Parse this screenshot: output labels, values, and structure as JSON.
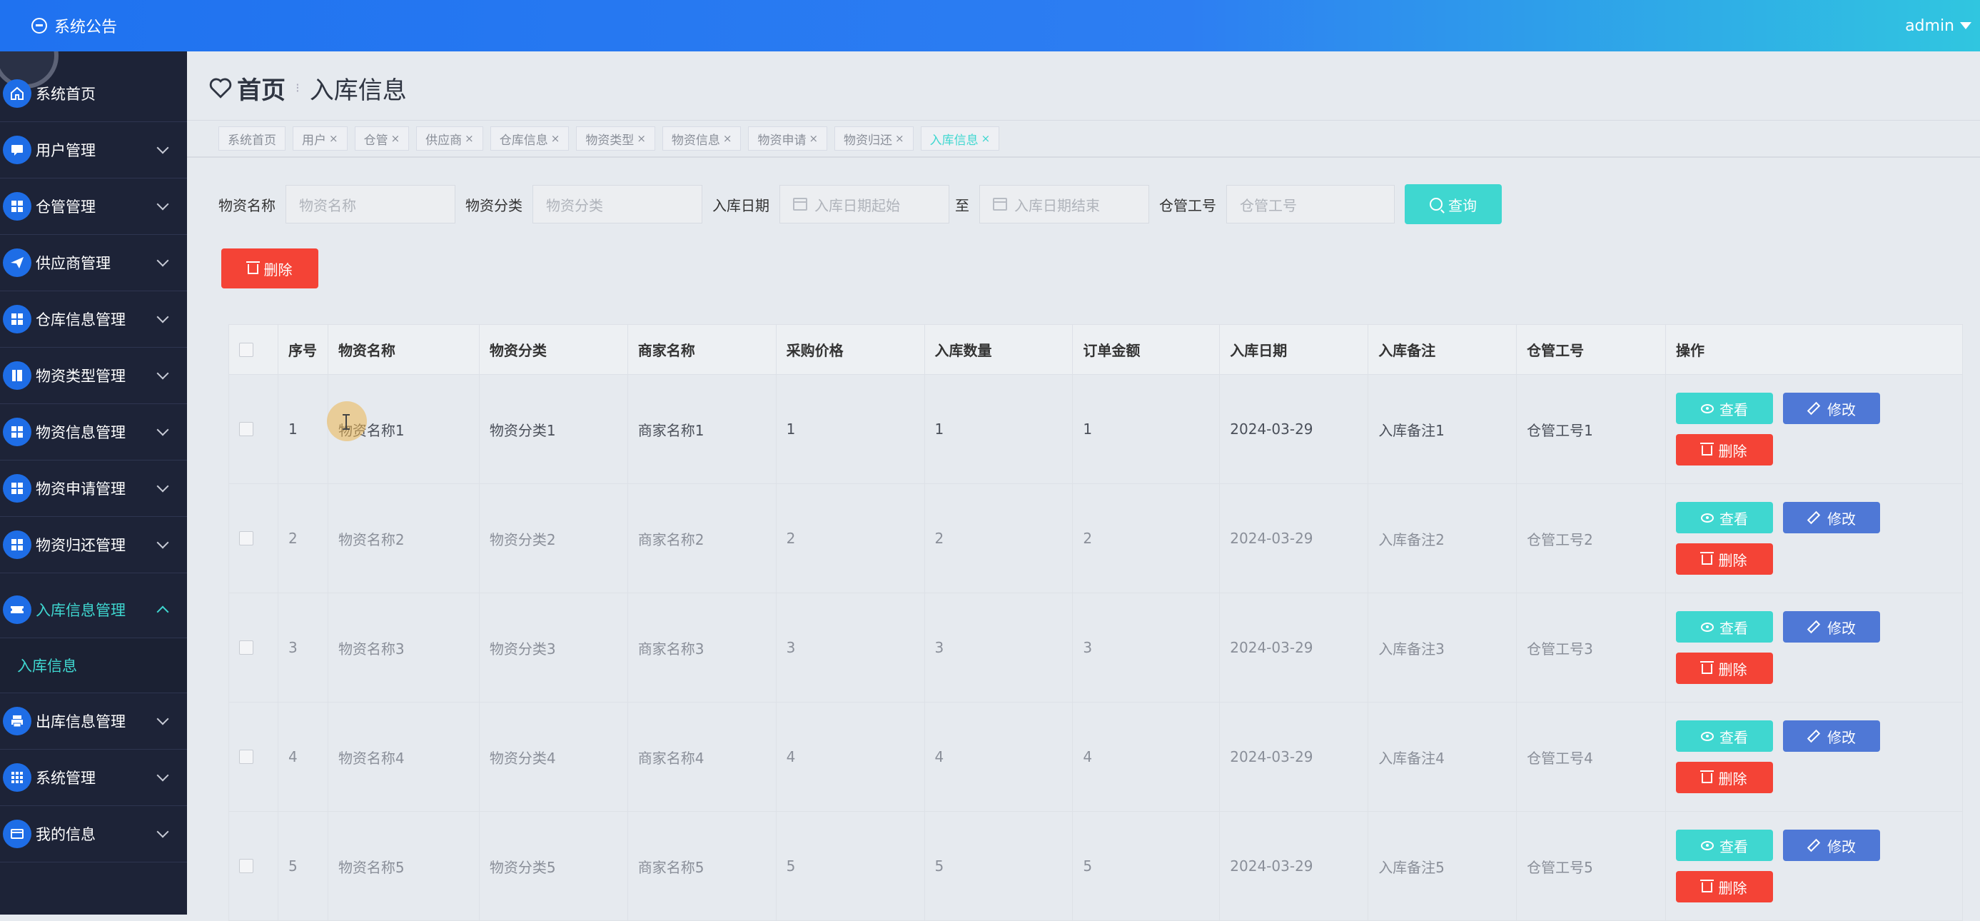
{
  "topbar": {
    "notice": "系统公告",
    "user": "admin"
  },
  "sidebar": {
    "items": [
      {
        "label": "系统首页",
        "icon": "home-icon"
      },
      {
        "label": "用户管理",
        "icon": "chat-icon"
      },
      {
        "label": "仓管管理",
        "icon": "grid-icon"
      },
      {
        "label": "供应商管理",
        "icon": "send-icon"
      },
      {
        "label": "仓库信息管理",
        "icon": "grid-icon"
      },
      {
        "label": "物资类型管理",
        "icon": "book-icon"
      },
      {
        "label": "物资信息管理",
        "icon": "grid-icon"
      },
      {
        "label": "物资申请管理",
        "icon": "grid-icon"
      },
      {
        "label": "物资归还管理",
        "icon": "grid-icon"
      },
      {
        "label": "入库信息管理",
        "icon": "ticket-icon"
      },
      {
        "label": "出库信息管理",
        "icon": "printer-icon"
      },
      {
        "label": "系统管理",
        "icon": "apps-icon"
      },
      {
        "label": "我的信息",
        "icon": "card-icon"
      }
    ],
    "submenu": "入库信息"
  },
  "breadcrumb": {
    "home": "首页",
    "current": "入库信息"
  },
  "tags": [
    {
      "label": "系统首页",
      "closable": false
    },
    {
      "label": "用户",
      "closable": true
    },
    {
      "label": "仓管",
      "closable": true
    },
    {
      "label": "供应商",
      "closable": true
    },
    {
      "label": "仓库信息",
      "closable": true
    },
    {
      "label": "物资类型",
      "closable": true
    },
    {
      "label": "物资信息",
      "closable": true
    },
    {
      "label": "物资申请",
      "closable": true
    },
    {
      "label": "物资归还",
      "closable": true
    },
    {
      "label": "入库信息",
      "closable": true
    }
  ],
  "filters": {
    "name_label": "物资名称",
    "name_placeholder": "物资名称",
    "category_label": "物资分类",
    "category_placeholder": "物资分类",
    "date_label": "入库日期",
    "date_start_placeholder": "入库日期起始",
    "to_label": "至",
    "date_end_placeholder": "入库日期结束",
    "worker_label": "仓管工号",
    "worker_placeholder": "仓管工号",
    "query_button": "查询",
    "delete_button": "删除"
  },
  "table": {
    "columns": [
      "序号",
      "物资名称",
      "物资分类",
      "商家名称",
      "采购价格",
      "入库数量",
      "订单金额",
      "入库日期",
      "入库备注",
      "仓管工号",
      "操作"
    ],
    "rows": [
      {
        "no": "1",
        "name": "物资名称1",
        "category": "物资分类1",
        "merchant": "商家名称1",
        "price": "1",
        "qty": "1",
        "amount": "1",
        "date": "2024-03-29",
        "remark": "入库备注1",
        "worker": "仓管工号1"
      },
      {
        "no": "2",
        "name": "物资名称2",
        "category": "物资分类2",
        "merchant": "商家名称2",
        "price": "2",
        "qty": "2",
        "amount": "2",
        "date": "2024-03-29",
        "remark": "入库备注2",
        "worker": "仓管工号2"
      },
      {
        "no": "3",
        "name": "物资名称3",
        "category": "物资分类3",
        "merchant": "商家名称3",
        "price": "3",
        "qty": "3",
        "amount": "3",
        "date": "2024-03-29",
        "remark": "入库备注3",
        "worker": "仓管工号3"
      },
      {
        "no": "4",
        "name": "物资名称4",
        "category": "物资分类4",
        "merchant": "商家名称4",
        "price": "4",
        "qty": "4",
        "amount": "4",
        "date": "2024-03-29",
        "remark": "入库备注4",
        "worker": "仓管工号4"
      },
      {
        "no": "5",
        "name": "物资名称5",
        "category": "物资分类5",
        "merchant": "商家名称5",
        "price": "5",
        "qty": "5",
        "amount": "5",
        "date": "2024-03-29",
        "remark": "入库备注5",
        "worker": "仓管工号5"
      }
    ],
    "ops": {
      "view": "查看",
      "edit": "修改",
      "delete": "删除"
    }
  },
  "colors": {
    "accent": "#3fd7d0",
    "primary": "#1f72f0",
    "danger": "#f44336",
    "edit": "#4f78d6",
    "sidebar_bg": "#1d2337"
  }
}
